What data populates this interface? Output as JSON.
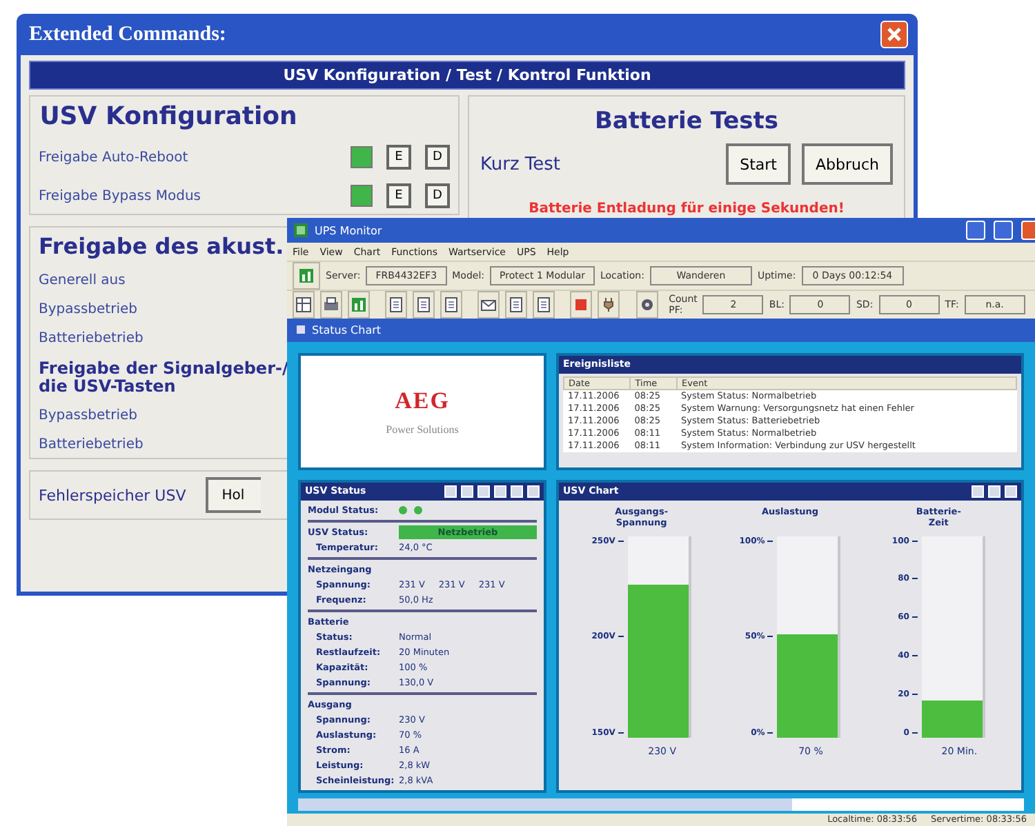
{
  "back_window": {
    "title": "Extended Commands:",
    "banner": "USV Konfiguration / Test / Kontrol Funktion",
    "config": {
      "heading": "USV Konfiguration",
      "rows": [
        {
          "label": "Freigabe Auto-Reboot",
          "on": true,
          "buttons": [
            "E",
            "D"
          ]
        },
        {
          "label": "Freigabe Bypass Modus",
          "on": true,
          "buttons": [
            "E",
            "D"
          ]
        }
      ]
    },
    "acoustic": {
      "heading": "Freigabe des akust.",
      "items": [
        "Generell aus",
        "Bypassbetrieb",
        "Batteriebetrieb"
      ],
      "subheading": "Freigabe der Signalgeber-/\ndie USV-Tasten",
      "subitems": [
        "Bypassbetrieb",
        "Batteriebetrieb"
      ]
    },
    "error_log": {
      "label": "Fehlerspeicher USV",
      "button": "Hol"
    },
    "battery_tests": {
      "heading": "Batterie Tests",
      "label": "Kurz Test",
      "buttons": [
        "Start",
        "Abbruch"
      ],
      "warning": "Batterie Entladung für einige Sekunden!"
    }
  },
  "front_window": {
    "title": "UPS Monitor",
    "menu": [
      "File",
      "View",
      "Chart",
      "Functions",
      "Wartservice",
      "UPS",
      "Help"
    ],
    "info_fields": [
      {
        "label": "Server:",
        "value": "FRB4432EF3"
      },
      {
        "label": "Model:",
        "value": "Protect 1 Modular"
      },
      {
        "label": "Location:",
        "value": "Wanderen"
      },
      {
        "label": "Uptime:",
        "value": "0 Days 00:12:54"
      }
    ],
    "counters": [
      {
        "label": "Count PF:",
        "value": "2"
      },
      {
        "label": "BL:",
        "value": "0"
      },
      {
        "label": "SD:",
        "value": "0"
      },
      {
        "label": "TF:",
        "value": "n.a."
      }
    ],
    "panel_title": "Status Chart",
    "logo": {
      "brand": "AEG",
      "tagline": "Power Solutions"
    },
    "events": {
      "title": "Ereignisliste",
      "columns": [
        "Date",
        "Time",
        "Event"
      ],
      "rows": [
        [
          "17.11.2006",
          "08:25",
          "System Status: Normalbetrieb"
        ],
        [
          "17.11.2006",
          "08:25",
          "System Warnung: Versorgungsnetz hat einen Fehler"
        ],
        [
          "17.11.2006",
          "08:25",
          "System Status: Batteriebetrieb"
        ],
        [
          "17.11.2006",
          "08:11",
          "System Status: Normalbetrieb"
        ],
        [
          "17.11.2006",
          "08:11",
          "System Information: Verbindung zur USV hergestellt"
        ]
      ]
    },
    "status": {
      "title": "USV Status",
      "module_label": "Modul Status:",
      "modules": [
        {
          "on": true
        },
        {
          "on": true
        }
      ],
      "usv_label": "USV Status:",
      "usv_value": "Netzbetrieb",
      "temperature": {
        "label": "Temperatur:",
        "value": "24,0 °C"
      },
      "sections": [
        {
          "heading": "Netzeingang",
          "rows": [
            {
              "label": "Spannung:",
              "values": [
                "231 V",
                "231 V",
                "231 V"
              ]
            },
            {
              "label": "Frequenz:",
              "values": [
                "50,0 Hz"
              ]
            }
          ]
        },
        {
          "heading": "Batterie",
          "rows": [
            {
              "label": "Status:",
              "values": [
                "Normal"
              ]
            },
            {
              "label": "Restlaufzeit:",
              "values": [
                "20 Minuten"
              ]
            },
            {
              "label": "Kapazität:",
              "values": [
                "100 %"
              ]
            },
            {
              "label": "Spannung:",
              "values": [
                "130,0 V"
              ]
            }
          ]
        },
        {
          "heading": "Ausgang",
          "rows": [
            {
              "label": "Spannung:",
              "values": [
                "230 V"
              ]
            },
            {
              "label": "Auslastung:",
              "values": [
                "70 %"
              ]
            },
            {
              "label": "Strom:",
              "values": [
                "16 A"
              ]
            },
            {
              "label": "Leistung:",
              "values": [
                "2,8 kW"
              ]
            },
            {
              "label": "Scheinleistung:",
              "values": [
                "2,8 kVA"
              ]
            }
          ]
        }
      ]
    },
    "chart": {
      "title": "USV Chart",
      "gauges": [
        {
          "title": "Ausgangs-\nSpannung",
          "ticks": [
            "250V",
            "200V",
            "150V"
          ],
          "level": 0.76,
          "reading": "230 V"
        },
        {
          "title": "Auslastung",
          "ticks": [
            "100%",
            "50%",
            "0%"
          ],
          "level": 0.51,
          "reading": "70 %"
        },
        {
          "title": "Batterie-\nZeit",
          "ticks": [
            "100",
            "80",
            "60",
            "40",
            "20",
            "0"
          ],
          "level": 0.18,
          "reading": "20 Min."
        }
      ]
    },
    "status_bar": [
      "Localtime: 08:33:56",
      "Servertime: 08:33:56"
    ]
  }
}
